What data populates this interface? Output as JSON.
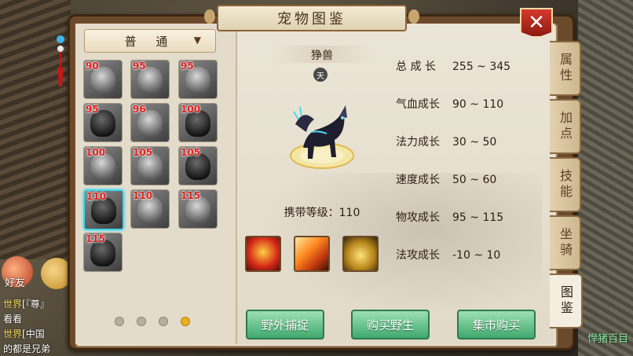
{
  "window": {
    "title": "宠物图鉴",
    "close_label": "✕"
  },
  "filter": {
    "selected": "普 通",
    "arrow": "▼"
  },
  "pets": [
    {
      "level": "90",
      "selected": false,
      "dark": false
    },
    {
      "level": "95",
      "selected": false,
      "dark": false
    },
    {
      "level": "95",
      "selected": false,
      "dark": false
    },
    {
      "level": "95",
      "selected": false,
      "dark": true
    },
    {
      "level": "96",
      "selected": false,
      "dark": false
    },
    {
      "level": "100",
      "selected": false,
      "dark": true
    },
    {
      "level": "100",
      "selected": false,
      "dark": false
    },
    {
      "level": "105",
      "selected": false,
      "dark": false
    },
    {
      "level": "105",
      "selected": false,
      "dark": true
    },
    {
      "level": "110",
      "selected": true,
      "dark": true
    },
    {
      "level": "110",
      "selected": false,
      "dark": false
    },
    {
      "level": "115",
      "selected": false,
      "dark": false
    },
    {
      "level": "115",
      "selected": false,
      "dark": true
    }
  ],
  "pagination": {
    "pages": 4,
    "current": 4
  },
  "detail": {
    "name": "狰兽",
    "rank_badge": "天",
    "carry_level": "携带等级：110",
    "stats": [
      {
        "label": "总 成 长",
        "value": "255 ~ 345"
      },
      {
        "label": "气血成长",
        "value": "90 ~ 110"
      },
      {
        "label": "法力成长",
        "value": "30 ~ 50"
      },
      {
        "label": "速度成长",
        "value": "50 ~ 60"
      },
      {
        "label": "物攻成长",
        "value": "95 ~ 115"
      },
      {
        "label": "法攻成长",
        "value": "-10 ~ 10"
      }
    ],
    "skills": [
      "fire-bird-skill-icon",
      "flame-burst-skill-icon",
      "golden-wing-skill-icon"
    ]
  },
  "side_tabs": [
    {
      "label": "属性",
      "active": false
    },
    {
      "label": "加点",
      "active": false
    },
    {
      "label": "技能",
      "active": false
    },
    {
      "label": "坐骑",
      "active": false
    },
    {
      "label": "图鉴",
      "active": true
    }
  ],
  "actions": {
    "wild_catch": "野外捕捉",
    "buy_wild": "购买野生",
    "market_buy": "集市购买"
  },
  "chat": {
    "friend_label": "好友",
    "lines": [
      {
        "channel": "世界",
        "text": "[『尊』"
      },
      {
        "channel": "",
        "text": "看看"
      },
      {
        "channel": "世界",
        "text": "[中国"
      },
      {
        "channel": "",
        "text": "的都是兄弟"
      }
    ],
    "right_text": "悍猪百目"
  }
}
